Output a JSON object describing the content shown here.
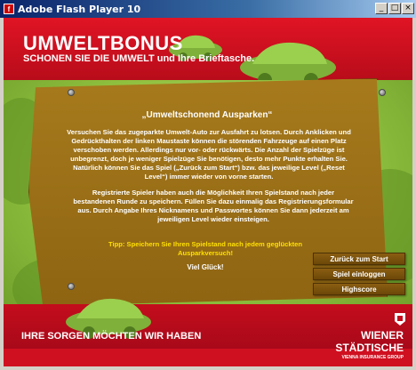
{
  "window": {
    "title": "Adobe Flash Player 10",
    "buttons": [
      "_",
      "□",
      "×"
    ]
  },
  "header": {
    "title": "UMWELTBONUS",
    "subtitle": "SCHONEN SIE DIE UMWELT und Ihre Brieftasche."
  },
  "board": {
    "title": "„Umweltschonend Ausparken“",
    "paragraph1": "Versuchen Sie das zugeparkte Umwelt-Auto zur Ausfahrt zu lotsen. Durch Anklicken und Gedrückthalten der linken Maustaste können die störenden Fahrzeuge auf einen Platz verschoben werden. Allerdings nur vor- oder rückwärts. Die Anzahl der Spielzüge ist unbegrenzt, doch je weniger Spielzüge Sie benötigen, desto mehr Punkte erhalten Sie. Natürlich können Sie das Spiel („Zurück zum Start“) bzw. das jeweilige Level („Reset Level“) immer wieder von vorne starten.",
    "paragraph2": "Registrierte Spieler haben auch die Möglichkeit Ihren Spielstand nach jeder bestandenen Runde zu speichern. Füllen Sie dazu einmalig das Registrierungsformular aus. Durch Angabe Ihres Nicknamens und Passwortes können Sie dann jederzeit am jeweiligen Level wieder einsteigen.",
    "tip": "Tipp: Speichern Sie Ihren Spielstand nach jedem geglückten Ausparkversuch!",
    "farewell": "Viel Glück!"
  },
  "menu": {
    "start": "Zurück zum Start",
    "login": "Spiel einloggen",
    "highscore": "Highscore"
  },
  "footer": {
    "slogan": "IHRE SORGEN MÖCHTEN WIR HABEN",
    "logo_line1": "WIENER",
    "logo_line2": "STÄDTISCHE",
    "logo_line3": "VIENNA INSURANCE GROUP"
  },
  "colors": {
    "brand_red": "#cf1020",
    "board_brown": "#a67a1c",
    "grass_green": "#8fbf3e",
    "tip_yellow": "#ffe000"
  },
  "icons": [
    "flash-app-icon",
    "minimize-icon",
    "maximize-icon",
    "close-icon",
    "green-car-icon",
    "nail-icon",
    "shield-emblem-icon"
  ]
}
